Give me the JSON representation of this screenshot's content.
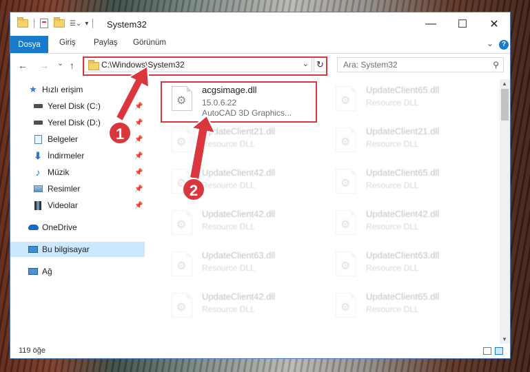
{
  "window": {
    "title": "System32",
    "controls": {
      "minimize": "—",
      "maximize": "☐",
      "close": "✕"
    }
  },
  "ribbon": {
    "tabs": [
      "Dosya",
      "Giriş",
      "Paylaş",
      "Görünüm"
    ],
    "help": "?"
  },
  "nav": {
    "back": "←",
    "forward": "→",
    "recent": "⌄",
    "up": "↑",
    "address": "C:\\Windows\\System32",
    "refresh": "↻",
    "search_placeholder": "Ara: System32"
  },
  "sidebar": {
    "items": [
      {
        "label": "Hızlı erişim",
        "icon": "star-icon",
        "pinned": false
      },
      {
        "label": "Yerel Disk (C:)",
        "icon": "drive-icon",
        "pinned": true
      },
      {
        "label": "Yerel Disk (D:)",
        "icon": "drive-icon",
        "pinned": true
      },
      {
        "label": "Belgeler",
        "icon": "documents-icon",
        "pinned": true
      },
      {
        "label": "İndirmeler",
        "icon": "download-icon",
        "pinned": true
      },
      {
        "label": "Müzik",
        "icon": "music-icon",
        "pinned": true
      },
      {
        "label": "Resimler",
        "icon": "pictures-icon",
        "pinned": true
      },
      {
        "label": "Videolar",
        "icon": "video-icon",
        "pinned": true
      },
      {
        "label": "OneDrive",
        "icon": "cloud-icon",
        "pinned": false
      },
      {
        "label": "Bu bilgisayar",
        "icon": "computer-icon",
        "pinned": false,
        "selected": true
      },
      {
        "label": "Ağ",
        "icon": "network-icon",
        "pinned": false
      }
    ]
  },
  "files": {
    "highlighted": {
      "name": "acgsimage.dll",
      "version": "15.0.6.22",
      "description": "AutoCAD 3D Graphics..."
    },
    "left_column": [
      {
        "name": "UpdateClient21.dll",
        "desc": "Resource DLL"
      },
      {
        "name": "UpdateClient42.dll",
        "desc": "Resource DLL"
      },
      {
        "name": "UpdateClient42.dll",
        "desc": "Resource DLL"
      },
      {
        "name": "UpdateClient63.dll",
        "desc": "Resource DLL"
      },
      {
        "name": "UpdateClient42.dll",
        "desc": "Resource DLL"
      }
    ],
    "right_column": [
      {
        "name": "UpdateClient65.dll",
        "desc": "Resource DLL"
      },
      {
        "name": "UpdateClient21.dll",
        "desc": "Resource DLL"
      },
      {
        "name": "UpdateClient65.dll",
        "desc": "Resource DLL"
      },
      {
        "name": "UpdateClient42.dll",
        "desc": "Resource DLL"
      },
      {
        "name": "UpdateClient63.dll",
        "desc": "Resource DLL"
      },
      {
        "name": "UpdateClient65.dll",
        "desc": "Resource DLL"
      }
    ]
  },
  "status": {
    "count": "119 öğe"
  },
  "annotations": {
    "step1": "1",
    "step2": "2",
    "accent": "#d9363e"
  }
}
